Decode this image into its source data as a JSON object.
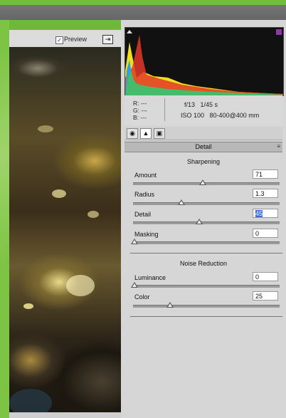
{
  "preview": {
    "label": "Preview",
    "checked": true
  },
  "info": {
    "r_label": "R:",
    "r_value": "---",
    "g_label": "G:",
    "g_value": "---",
    "b_label": "B:",
    "b_value": "---",
    "aperture": "f/13",
    "shutter": "1/45 s",
    "iso": "ISO 100",
    "lens": "80-400@400 mm"
  },
  "tabs": [
    {
      "icon": "aperture-icon",
      "active": false
    },
    {
      "icon": "detail-triangle-icon",
      "active": true
    },
    {
      "icon": "camera-icon",
      "active": false
    }
  ],
  "panel": {
    "title": "Detail",
    "menu_icon": "panel-menu-icon"
  },
  "sharpening": {
    "title": "Sharpening",
    "controls": [
      {
        "label": "Amount",
        "value": "71",
        "fraction": 0.47
      },
      {
        "label": "Radius",
        "value": "1.3",
        "fraction": 0.33
      },
      {
        "label": "Detail",
        "value": "45",
        "fraction": 0.45,
        "selected": true
      },
      {
        "label": "Masking",
        "value": "0",
        "fraction": 0.0
      }
    ]
  },
  "noise_reduction": {
    "title": "Noise Reduction",
    "controls": [
      {
        "label": "Luminance",
        "value": "0",
        "fraction": 0.0
      },
      {
        "label": "Color",
        "value": "25",
        "fraction": 0.25
      }
    ]
  },
  "colors": {
    "accent_green": "#72bd3a",
    "selection": "#3a6fd8"
  }
}
